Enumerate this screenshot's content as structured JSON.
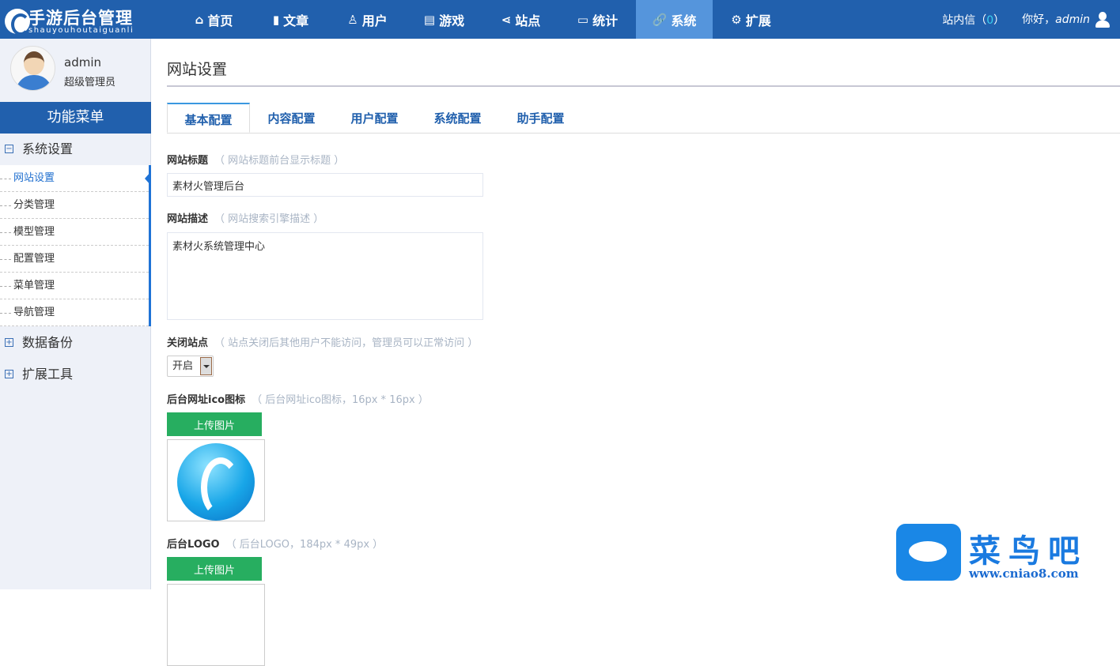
{
  "header": {
    "logo_title": "手游后台管理",
    "logo_sub": "shauyouhoutaiguanli",
    "nav": [
      {
        "label": "首页",
        "icon": "home-icon",
        "glyph": "⌂"
      },
      {
        "label": "文章",
        "icon": "bar-chart-icon",
        "glyph": "▮"
      },
      {
        "label": "用户",
        "icon": "user-pin-icon",
        "glyph": "♙"
      },
      {
        "label": "游戏",
        "icon": "document-icon",
        "glyph": "▤"
      },
      {
        "label": "站点",
        "icon": "share-icon",
        "glyph": "⋖"
      },
      {
        "label": "统计",
        "icon": "monitor-icon",
        "glyph": "▭"
      },
      {
        "label": "系统",
        "icon": "link-icon",
        "glyph": "🔗"
      },
      {
        "label": "扩展",
        "icon": "gear-icon",
        "glyph": "⚙"
      }
    ],
    "active_nav": "系统",
    "messages_label": "站内信（",
    "messages_count": "0",
    "messages_close": "）",
    "greeting": "你好，",
    "username": "admin"
  },
  "sidebar": {
    "user": "admin",
    "role": "超级管理员",
    "menu_title": "功能菜单",
    "groups": [
      {
        "label": "系统设置",
        "toggle": "−"
      },
      {
        "label": "数据备份",
        "toggle": "+"
      },
      {
        "label": "扩展工具",
        "toggle": "+"
      }
    ],
    "items": [
      "网站设置",
      "分类管理",
      "模型管理",
      "配置管理",
      "菜单管理",
      "导航管理"
    ]
  },
  "main": {
    "title": "网站设置",
    "tabs": [
      "基本配置",
      "内容配置",
      "用户配置",
      "系统配置",
      "助手配置"
    ],
    "fields": {
      "site_title": {
        "label": "网站标题",
        "hint": "（ 网站标题前台显示标题 ）",
        "value": "素材火管理后台"
      },
      "site_desc": {
        "label": "网站描述",
        "hint": "（ 网站搜索引擎描述 ）",
        "value": "素材火系统管理中心"
      },
      "close_site": {
        "label": "关闭站点",
        "hint": "（ 站点关闭后其他用户不能访问，管理员可以正常访问 ）",
        "value": "开启"
      },
      "ico": {
        "label": "后台网址ico图标",
        "hint": "（ 后台网址ico图标，16px * 16px ）",
        "button": "上传图片"
      },
      "logo": {
        "label": "后台LOGO",
        "hint": "（ 后台LOGO，184px * 49px ）",
        "button": "上传图片"
      }
    }
  },
  "watermark": {
    "text": "菜鸟吧",
    "url": "www.cniao8.com"
  }
}
